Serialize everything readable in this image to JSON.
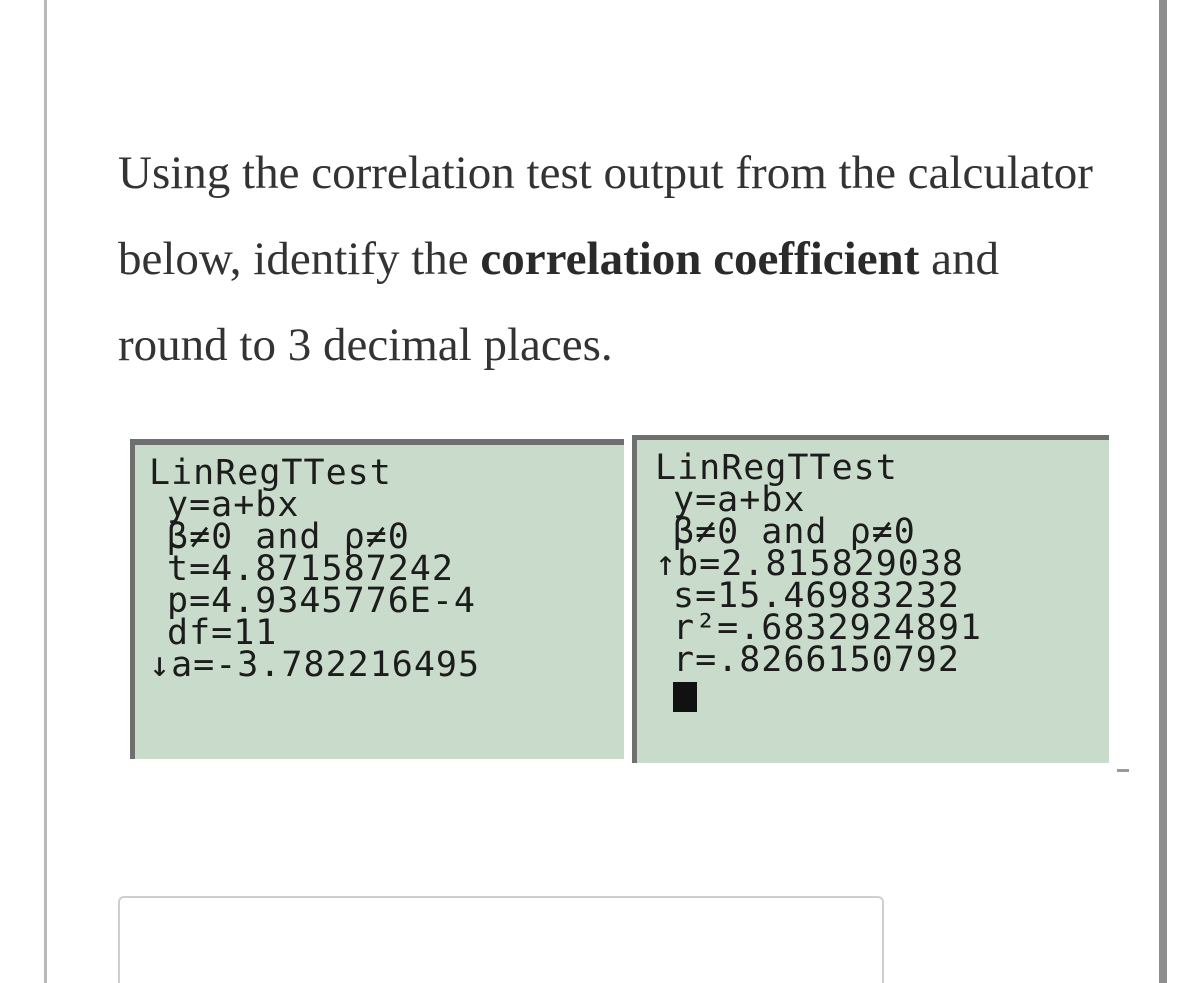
{
  "question": {
    "part1": "Using the correlation test output from the calculator below, identify the ",
    "bold1": "correlation",
    "space": " ",
    "bold2": "coefficient",
    "part2": " and round to 3 decimal places."
  },
  "calculator_left": {
    "lines": [
      "LinRegTTest",
      "y=a+bx",
      "β≠0 and ρ≠0",
      "t=4.871587242",
      "p=4.9345776E-4",
      "df=11",
      "↓a=-3.782216495"
    ]
  },
  "calculator_right": {
    "lines": [
      "LinRegTTest",
      "y=a+bx",
      "β≠0 and ρ≠0",
      "↑b=2.815829038",
      "s=15.46983232",
      "r²=.6832924891",
      "r=.8266150792"
    ]
  },
  "answer": {
    "value": "",
    "placeholder": ""
  },
  "colors": {
    "screen_bg": "#c9dccb",
    "screen_border": "#6f6f6f",
    "text": "#333333"
  }
}
